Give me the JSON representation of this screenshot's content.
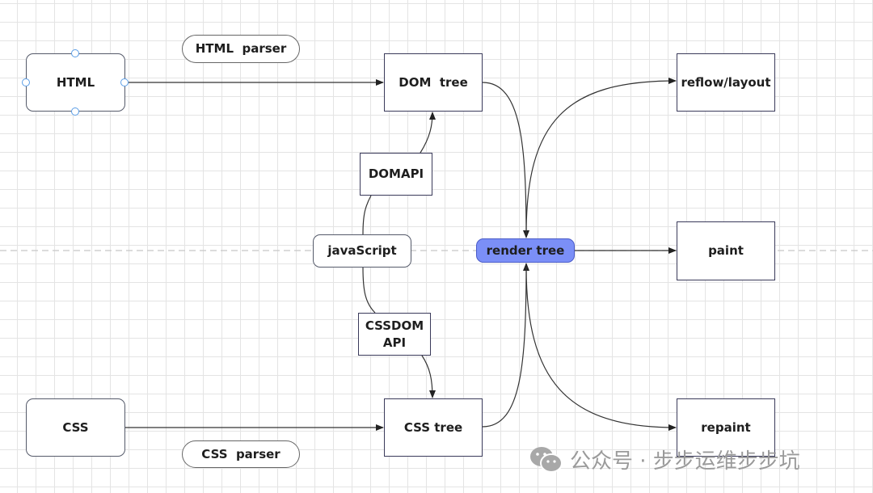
{
  "nodes": {
    "html": "HTML",
    "html_parser": "HTML  parser",
    "dom_tree": "DOM  tree",
    "reflow_layout": "reflow/layout",
    "domapi": "DOMAPI",
    "javascript": "javaScript",
    "render_tree": "render tree",
    "paint": "paint",
    "cssdom_api_line1": "CSSDOM",
    "cssdom_api_line2": "API",
    "css": "CSS",
    "css_tree": "CSS tree",
    "repaint": "repaint",
    "css_parser": "CSS  parser"
  },
  "colors": {
    "render_tree_fill": "#7b8ff7",
    "stroke": "#333333",
    "handle": "#5a9de6"
  },
  "watermark": {
    "icon": "wechat-icon",
    "text": "公众号 · 步步运维步步坑"
  }
}
